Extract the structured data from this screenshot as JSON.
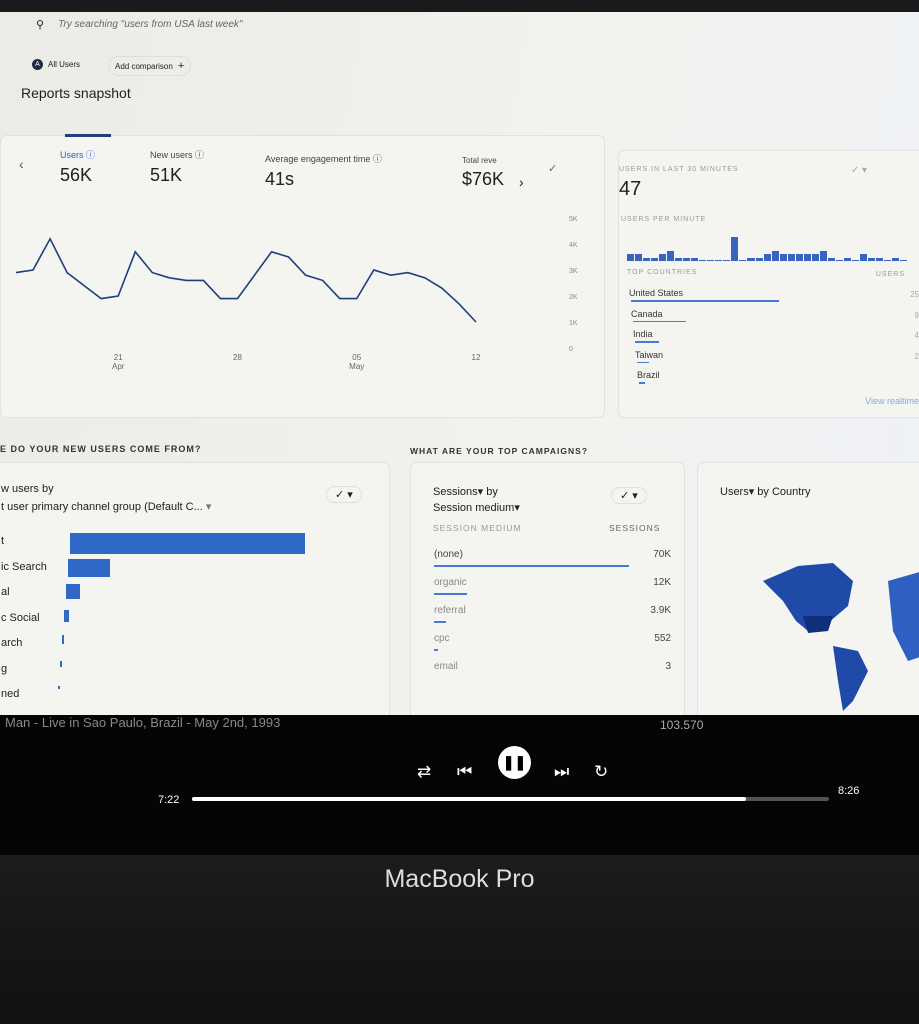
{
  "search": {
    "placeholder": "Try searching \"users from USA last week\""
  },
  "comparison": {
    "segment_initial": "A",
    "segment": "All Users",
    "add_label": "Add comparison",
    "add_icon": "+"
  },
  "page_title": "Reports snapshot",
  "metrics": [
    {
      "label": "Users",
      "value": "56K",
      "help": "?"
    },
    {
      "label": "New users",
      "value": "51K",
      "help": "?"
    },
    {
      "label": "Average engagement time",
      "value": "41s",
      "help": "?"
    },
    {
      "label": "Total reve",
      "value": "$76K"
    }
  ],
  "chart_data": {
    "type": "line",
    "x": [
      "Apr 15",
      "Apr 16",
      "Apr 17",
      "Apr 18",
      "Apr 19",
      "Apr 20",
      "Apr 21",
      "Apr 22",
      "Apr 23",
      "Apr 24",
      "Apr 25",
      "Apr 26",
      "Apr 27",
      "Apr 28",
      "Apr 29",
      "Apr 30",
      "May 01",
      "May 02",
      "May 03",
      "May 04",
      "May 05",
      "May 06",
      "May 07",
      "May 08",
      "May 09",
      "May 10",
      "May 11",
      "May 12"
    ],
    "values": [
      2900,
      3000,
      4200,
      2900,
      2400,
      1900,
      2000,
      3700,
      2900,
      2700,
      2600,
      2600,
      1900,
      1900,
      2800,
      3700,
      3500,
      2800,
      2600,
      1900,
      1900,
      3000,
      2800,
      2900,
      2700,
      2300,
      1700,
      1000
    ],
    "ylim": [
      0,
      5000
    ],
    "y_ticks": [
      "0",
      "1K",
      "2K",
      "3K",
      "4K",
      "5K"
    ],
    "x_ticks": [
      {
        "day": "21",
        "month": "Apr"
      },
      {
        "day": "28",
        "month": ""
      },
      {
        "day": "05",
        "month": "May"
      },
      {
        "day": "12",
        "month": ""
      }
    ],
    "color": "#1f3f7a"
  },
  "realtime": {
    "title": "USERS IN LAST 30 MINUTES",
    "value": "47",
    "per_minute_label": "USERS PER MINUTE",
    "per_minute": [
      2,
      2,
      1,
      1,
      2,
      3,
      1,
      1,
      1,
      0,
      0,
      0,
      0,
      7,
      0,
      1,
      1,
      2,
      3,
      2,
      2,
      2,
      2,
      2,
      3,
      1,
      0,
      1,
      0,
      2,
      1,
      1,
      0,
      1,
      0
    ],
    "countries_header": "TOP COUNTRIES",
    "users_header": "USERS",
    "countries": [
      {
        "name": "United States",
        "users": "25",
        "share": 1
      },
      {
        "name": "Canada",
        "users": "9",
        "share": 0.36
      },
      {
        "name": "India",
        "users": "4",
        "share": 0.16
      },
      {
        "name": "Taiwan",
        "users": "2",
        "share": 0.08
      },
      {
        "name": "Brazil",
        "users": "",
        "share": 0.04
      }
    ],
    "link": "View realtime"
  },
  "new_users": {
    "section": "E DO YOUR NEW USERS COME FROM?",
    "title_line1": "w users by",
    "title_line2": "t user primary channel group (Default C...",
    "channels": [
      {
        "label": "t",
        "share": 1
      },
      {
        "label": "ic Search",
        "share": 0.18
      },
      {
        "label": "al",
        "share": 0.06
      },
      {
        "label": "c Social",
        "share": 0.02
      },
      {
        "label": "arch",
        "share": 0.01
      },
      {
        "label": "g",
        "share": 0.005
      },
      {
        "label": "ned",
        "share": 0.003
      }
    ]
  },
  "campaigns": {
    "section": "WHAT ARE YOUR TOP CAMPAIGNS?",
    "title_line1": "Sessions▾ by",
    "title_line2": "Session medium▾",
    "col1": "SESSION MEDIUM",
    "col2": "SESSIONS",
    "rows": [
      {
        "medium": "(none)",
        "sessions": "70K",
        "share": 1
      },
      {
        "medium": "organic",
        "sessions": "12K",
        "share": 0.17
      },
      {
        "medium": "referral",
        "sessions": "3.9K",
        "share": 0.06
      },
      {
        "medium": "cpc",
        "sessions": "552",
        "share": 0.01
      },
      {
        "medium": "email",
        "sessions": "3",
        "share": 0
      }
    ]
  },
  "country_map": {
    "title": "Users▾ by Country",
    "color": "#1f4aa8"
  },
  "player": {
    "track": "Man - Live in Sao Paulo, Brazil - May 2nd, 1993",
    "count": "103.570",
    "elapsed": "7:22",
    "total": "8:26",
    "progress": 0.87
  },
  "bezel_label": "MacBook Pro"
}
